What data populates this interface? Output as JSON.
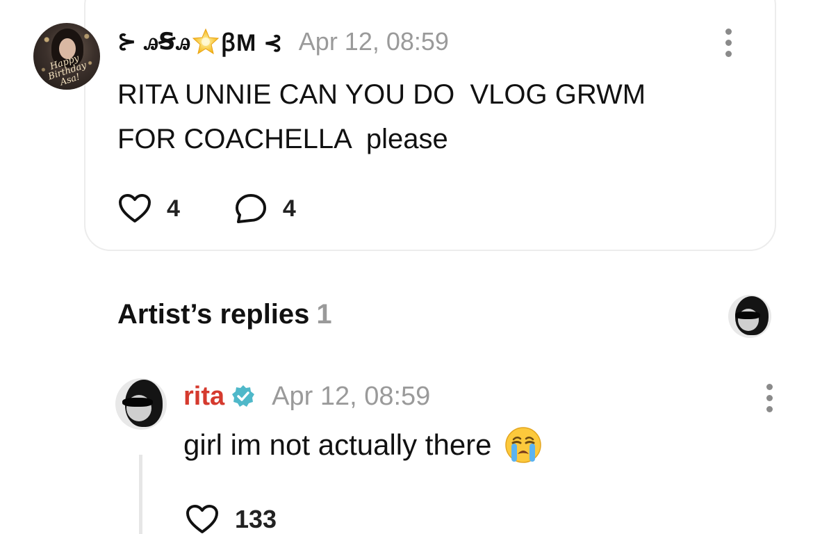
{
  "post": {
    "avatar_caption": "Happy Birthday Asa!",
    "username_prefix": "⊱ ꭿꞨꭿ",
    "username_suffix": "ꞵM ⊰",
    "timestamp": "Apr 12, 08:59",
    "body": "RITA UNNIE CAN YOU DO  VLOG GRWM\nFOR COACHELLA  please",
    "likes": "4",
    "comments": "4"
  },
  "artist_replies": {
    "title": "Artist’s replies",
    "count": "1"
  },
  "reply": {
    "username": "rita",
    "timestamp": "Apr 12, 08:59",
    "body": "girl im not actually there",
    "likes": "133"
  },
  "colors": {
    "reply_name": "#d53a2e",
    "verified": "#4fb8c9",
    "muted": "#9a9a9a"
  },
  "icons": [
    "star-icon",
    "more-icon",
    "heart-icon",
    "comment-icon",
    "verified-icon",
    "crying-face-icon"
  ]
}
